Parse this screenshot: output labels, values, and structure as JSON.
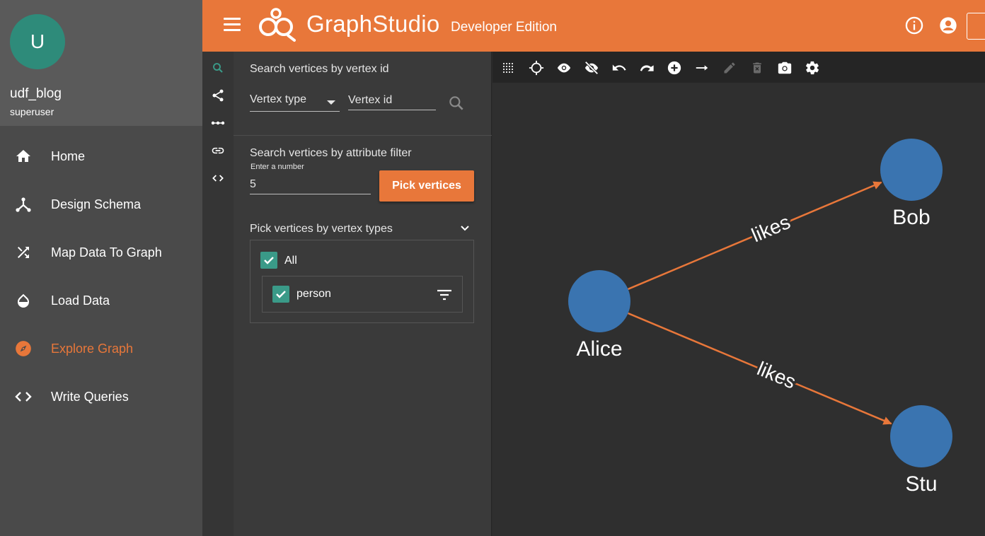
{
  "user": {
    "initial": "U",
    "name": "udf_blog",
    "role": "superuser"
  },
  "nav": {
    "items": [
      {
        "label": "Home",
        "icon": "home-icon"
      },
      {
        "label": "Design Schema",
        "icon": "schema-icon"
      },
      {
        "label": "Map Data To Graph",
        "icon": "shuffle-icon"
      },
      {
        "label": "Load Data",
        "icon": "drop-icon"
      },
      {
        "label": "Explore Graph",
        "icon": "compass-icon",
        "active": true
      },
      {
        "label": "Write Queries",
        "icon": "code-icon"
      }
    ]
  },
  "header": {
    "brand_part1": "Graph",
    "brand_part2": "Studio",
    "edition": "Developer Edition",
    "color": "#e8773a"
  },
  "rail": [
    "search-icon",
    "share-icon",
    "path-icon",
    "link-icon",
    "code-icon"
  ],
  "search": {
    "by_id_title": "Search vertices by vertex id",
    "vertex_type_label": "Vertex type",
    "vertex_id_placeholder": "Vertex id",
    "by_attr_title": "Search vertices by attribute filter",
    "number_hint": "Enter a number",
    "number_value": "5",
    "pick_button": "Pick vertices",
    "types_title": "Pick vertices by vertex types",
    "types": [
      {
        "label": "All",
        "checked": true
      },
      {
        "label": "person",
        "checked": true
      }
    ]
  },
  "toolbar": [
    "select-all-icon",
    "locate-icon",
    "show-icon",
    "hide-icon",
    "undo-icon",
    "redo-icon",
    "add-vertex-icon",
    "add-edge-icon",
    "edit-icon",
    "delete-icon",
    "screenshot-icon",
    "settings-icon"
  ],
  "graph": {
    "vertices": [
      {
        "id": "Alice",
        "label": "Alice"
      },
      {
        "id": "Bob",
        "label": "Bob"
      },
      {
        "id": "Stu",
        "label": "Stu"
      }
    ],
    "edges": [
      {
        "from": "Alice",
        "to": "Bob",
        "label": "likes"
      },
      {
        "from": "Alice",
        "to": "Stu",
        "label": "likes"
      }
    ],
    "vertex_color": "#3a74b0",
    "edge_color": "#e8773a"
  }
}
